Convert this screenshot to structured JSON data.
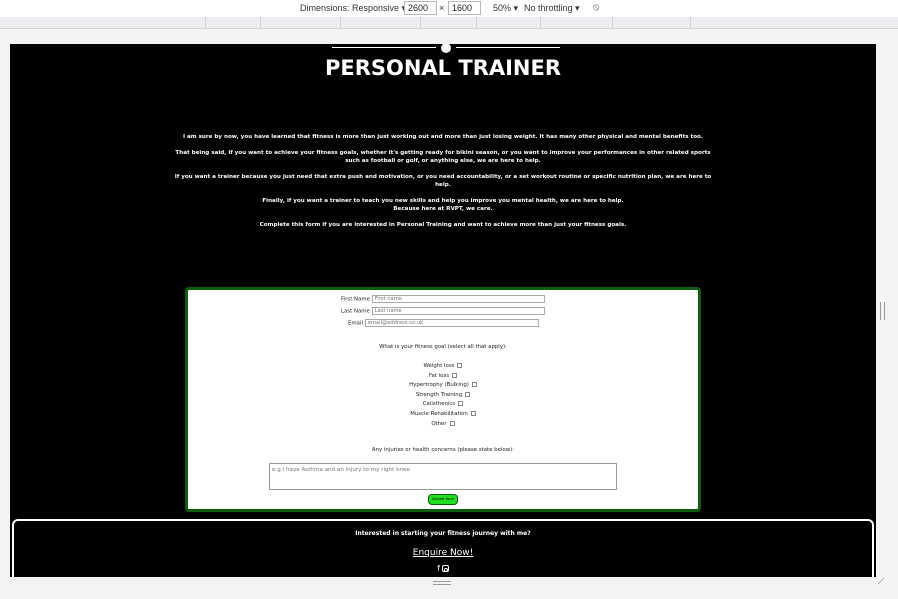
{
  "devtools": {
    "dimensions_label": "Dimensions: Responsive ▾",
    "width": "2600",
    "times": "×",
    "height": "1600",
    "zoom": "50% ▾",
    "throttling": "No throttling ▾",
    "rotate_icon": "⦸"
  },
  "page": {
    "title": "PERSONAL TRAINER",
    "intro": [
      "I am sure by now, you have learned that fitness is more than just working out and more than just losing weight. It has many other physical and mental benefits too.",
      "That being said, if you want to achieve your fitness goals, whether it's getting ready for bikini season, or you want to improve your performances in other related sports such as football or golf, or anything else, we are here to help.",
      "If you want a trainer because you just need that extra push and motivation, or you need accountability, or a set workout routine or specific nutrition plan, we are here to help.",
      "Finally, if you want a trainer to teach you new skills and help you improve you mental health, we are here to help.",
      "Because here at RVPT, we care.",
      "Complete this form if you are interested in Personal Training and want to achieve more than just your fitness goals."
    ]
  },
  "form": {
    "first_name_label": "First Name",
    "first_name_placeholder": "First name",
    "last_name_label": "Last Name",
    "last_name_placeholder": "Last name",
    "email_label": "Email",
    "email_placeholder": "email@address.co.uk",
    "goal_question": "What is your fitness goal (select all that apply):",
    "goals": [
      "Weight loss",
      "Fat loss",
      "Hypertrophy (Bulking)",
      "Strength Training",
      "Calisthenics",
      "Muscle Rehabilitation",
      "Other"
    ],
    "injury_question": "Any injuries or health concerns (please state below):",
    "injury_placeholder": "e.g I have Asthma and an injury to my right knee",
    "submit_label": "Submit form"
  },
  "footer": {
    "question": "Interested in starting your fitness journey with me?",
    "enquire": "Enquire Now!",
    "facebook_glyph": "f"
  },
  "colors": {
    "background": "#000000",
    "form_border": "#0f5e0f",
    "submit": "#22dd22"
  }
}
